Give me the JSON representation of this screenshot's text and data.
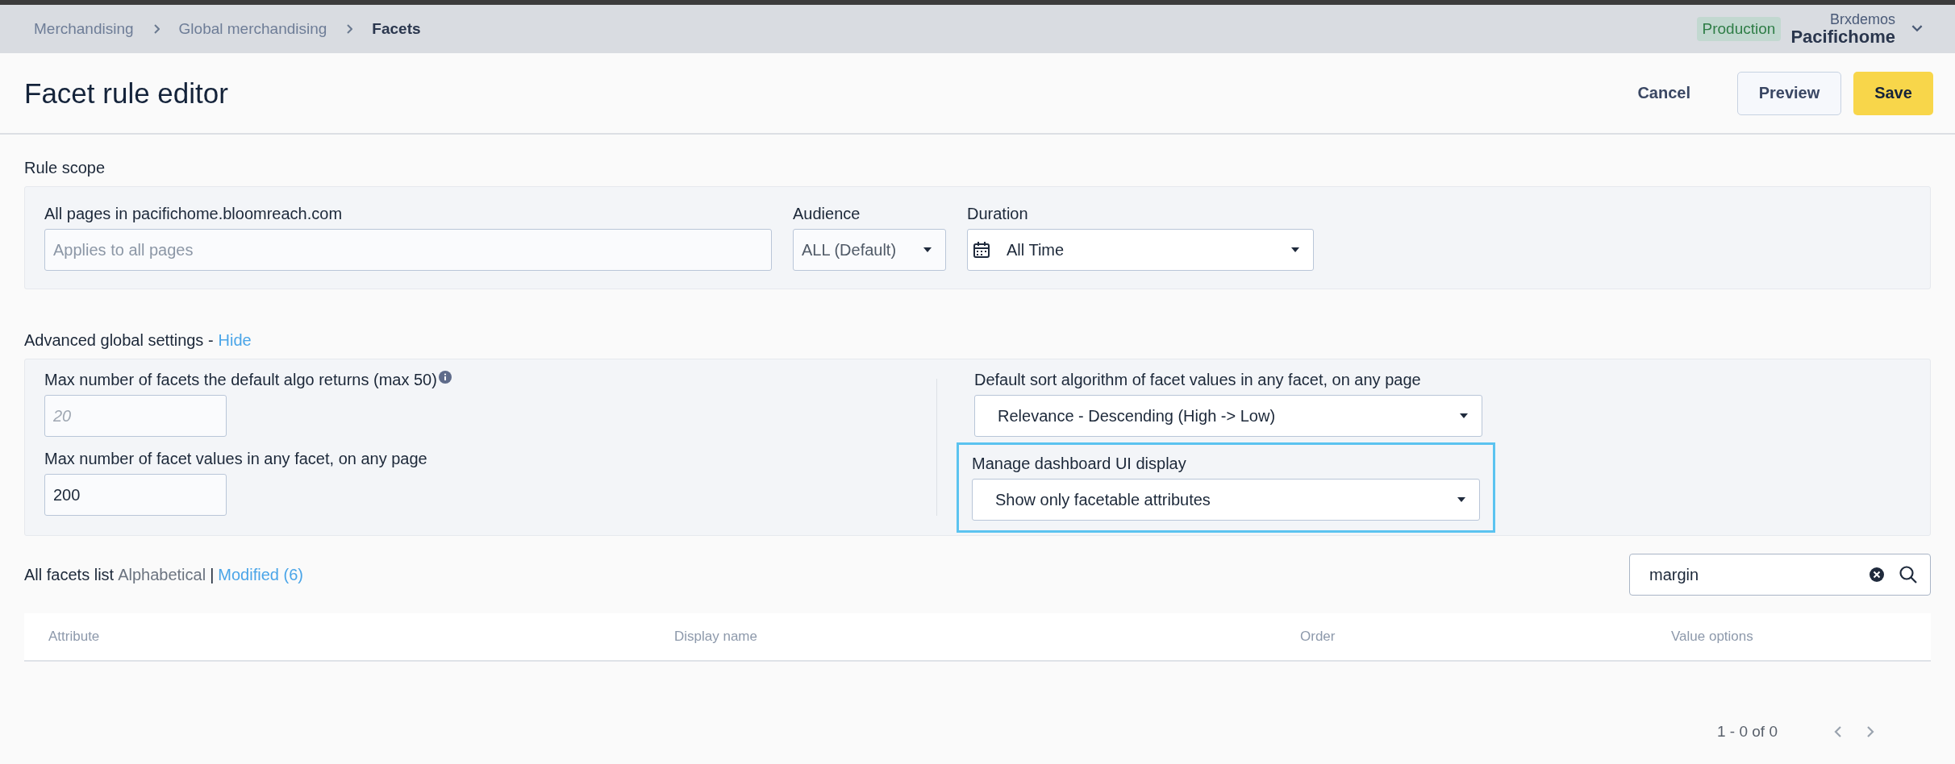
{
  "breadcrumbs": [
    {
      "label": "Merchandising",
      "current": false
    },
    {
      "label": "Global merchandising",
      "current": false
    },
    {
      "label": "Facets",
      "current": true
    }
  ],
  "environment_badge": "Production",
  "account": {
    "org": "Brxdemos",
    "site": "Pacifichome"
  },
  "page_title": "Facet rule editor",
  "actions": [
    {
      "label": "Cancel",
      "kind": "text"
    },
    {
      "label": "Preview",
      "kind": "outline"
    },
    {
      "label": "Save",
      "kind": "primary"
    }
  ],
  "rule_scope": {
    "heading": "Rule scope",
    "fields": [
      {
        "kind": "text",
        "label": "All pages in pacifichome.bloomreach.com",
        "placeholder": "Applies to all pages"
      },
      {
        "kind": "select",
        "label": "Audience",
        "value": "ALL (Default)"
      },
      {
        "kind": "date-select",
        "label": "Duration",
        "value": "All Time"
      }
    ]
  },
  "advanced": {
    "heading": "Advanced global settings -",
    "toggle_link": "Hide",
    "left": [
      {
        "kind": "number",
        "label": "Max number of facets the default algo returns (max 50)",
        "info": true,
        "placeholder": "20"
      },
      {
        "kind": "number",
        "label": "Max number of facet values in any facet, on any page",
        "info": false,
        "value": "200"
      }
    ],
    "right": [
      {
        "kind": "select",
        "label": "Default sort algorithm of facet values in any facet, on any page",
        "value": "Relevance - Descending (High -> Low)",
        "highlighted": false
      },
      {
        "kind": "select",
        "label": "Manage dashboard UI display",
        "value": "Show only facetable attributes",
        "highlighted": true
      }
    ]
  },
  "facets_list": {
    "heading": "All facets list",
    "separator": "|",
    "sort_options": [
      {
        "label": "Alphabetical",
        "selected": true
      },
      {
        "label": "Modified (6)",
        "selected": false
      }
    ],
    "search": {
      "value": "margin"
    },
    "columns": [
      "Attribute",
      "Display name",
      "Order",
      "Value options"
    ],
    "pagination": "1 - 0 of 0"
  }
}
